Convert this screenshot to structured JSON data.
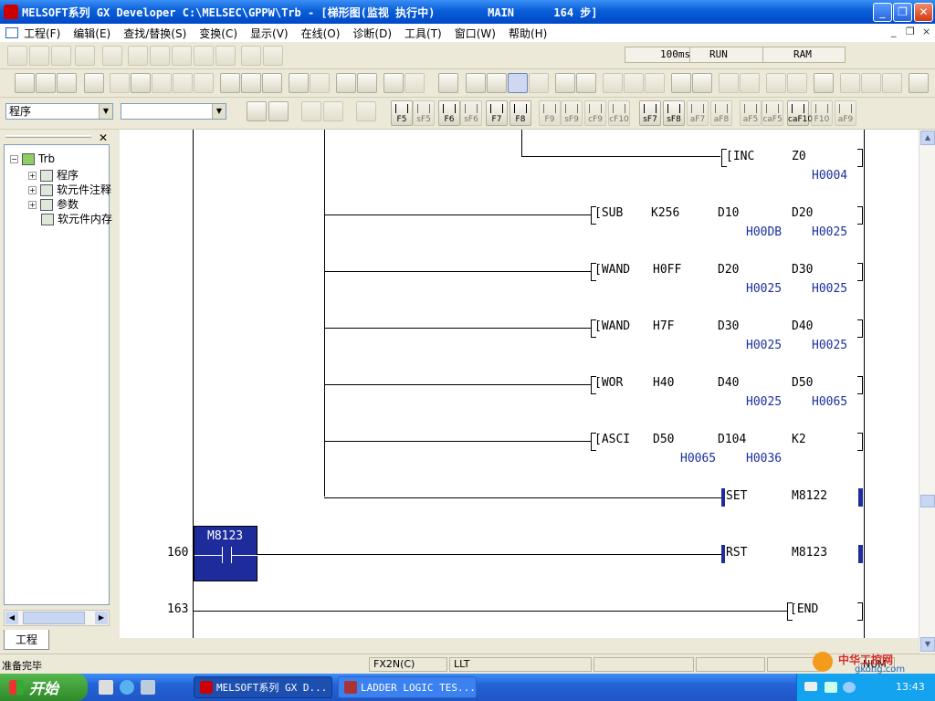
{
  "window": {
    "title": "MELSOFT系列 GX Developer C:\\MELSEC\\GPPW\\Trb - [梯形图(监视 执行中)        MAIN      164 步]",
    "minimize": "_",
    "restore": "❐",
    "close": "✕"
  },
  "menu": {
    "items": [
      "工程(F)",
      "编辑(E)",
      "查找/替换(S)",
      "变换(C)",
      "显示(V)",
      "在线(O)",
      "诊断(D)",
      "工具(T)",
      "窗口(W)",
      "帮助(H)"
    ],
    "mdi_buttons": [
      "_",
      "❐",
      "×"
    ]
  },
  "monitor_status": {
    "scan_time": "100ms",
    "run_state": "RUN",
    "memory": "RAM"
  },
  "selectors": {
    "data_type": "程序",
    "data_name": ""
  },
  "fkeys": [
    "F5",
    "sF5",
    "F6",
    "sF6",
    "F7",
    "F8",
    "F9",
    "sF9",
    "cF9",
    "cF10",
    "sF7",
    "sF8",
    "aF7",
    "aF8",
    "aF5",
    "caF5",
    "caF10",
    "F10",
    "aF9"
  ],
  "tree": {
    "root": "Trb",
    "items": [
      "程序",
      "软元件注释",
      "参数",
      "软元件内存"
    ],
    "tab": "工程"
  },
  "ladder": {
    "rows": [
      {
        "fields": [
          "[INC",
          "Z0"
        ],
        "mon": [
          "H0004"
        ]
      },
      {
        "fields": [
          "[SUB",
          "K256",
          "D10",
          "D20"
        ],
        "mon": [
          "H00DB",
          "H0025"
        ]
      },
      {
        "fields": [
          "[WAND",
          "H0FF",
          "D20",
          "D30"
        ],
        "mon": [
          "H0025",
          "H0025"
        ]
      },
      {
        "fields": [
          "[WAND",
          "H7F",
          "D30",
          "D40"
        ],
        "mon": [
          "H0025",
          "H0025"
        ]
      },
      {
        "fields": [
          "[WOR",
          "H40",
          "D40",
          "D50"
        ],
        "mon": [
          "H0025",
          "H0065"
        ]
      },
      {
        "fields": [
          "[ASCI",
          "D50",
          "D104",
          "K2"
        ],
        "mon": [
          "H0065",
          "H0036"
        ]
      },
      {
        "fields": [
          "SET",
          "M8122"
        ]
      },
      {
        "fields": [
          "RST",
          "M8123"
        ]
      },
      {
        "fields": [
          "[END"
        ]
      }
    ],
    "contact": "M8123",
    "step_numbers": [
      "160",
      "163"
    ]
  },
  "status": {
    "message": "准备完毕",
    "plc_type": "FX2N(C)",
    "mode": "LLT",
    "num": "NUM"
  },
  "taskbar": {
    "start": "开始",
    "apps": [
      "MELSOFT系列 GX D...",
      "LADDER LOGIC TES..."
    ],
    "clock": "13:43",
    "watermark_site": "中华工控网",
    "watermark_url": "gkong.com"
  }
}
